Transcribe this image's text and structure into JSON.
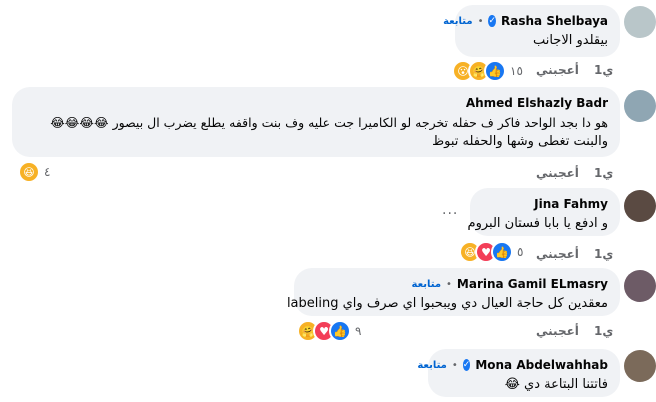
{
  "comments": [
    {
      "author": "Rasha Shelbaya",
      "follow_label": "متابعة",
      "verified": true,
      "text_lines": [
        "بيقلدو الاجانب"
      ],
      "like_label": "أعجبني",
      "time": "1ي",
      "reaction_count": "١٥",
      "reactions": [
        "wow",
        "care",
        "like"
      ]
    },
    {
      "author": "Ahmed Elshazly Badr",
      "verified": false,
      "text_lines": [
        "هو دا بجد الواحد فاكر ف حفله تخرجه لو الكاميرا جت عليه وف بنت واقفه يطلع يضرب ال بيصور 😂😂😂😂",
        "والبنت تغطى وشها والحفله تبوظ"
      ],
      "like_label": "أعجبني",
      "time": "1ي",
      "reaction_count": "٤",
      "reactions": [
        "haha"
      ]
    },
    {
      "author": "Jina Fahmy",
      "verified": false,
      "text_lines": [
        "و ادفع يا بابا فستان البروم"
      ],
      "more_label": "...",
      "like_label": "أعجبني",
      "time": "1ي",
      "reaction_count": "٥",
      "reactions": [
        "haha",
        "love",
        "like"
      ]
    },
    {
      "author": "Marina Gamil ELmasry",
      "follow_label": "متابعة",
      "verified": false,
      "text_lines": [
        "معقدين كل حاجة العيال دي ويبحبوا اي صرف واي labeling"
      ],
      "like_label": "أعجبني",
      "time": "1ي",
      "reaction_count": "٩",
      "reactions": [
        "care",
        "love",
        "like"
      ]
    },
    {
      "author": "Mona Abdelwahhab",
      "follow_label": "متابعة",
      "verified": true,
      "text_lines": [
        "فاتتنا البتاعة دي 😂"
      ]
    }
  ],
  "colors": {
    "bubble": "#f0f2f5",
    "follow": "#0064d1",
    "meta": "#65676b",
    "like": "#1877f2",
    "love": "#f33e58",
    "haha": "#f7b125"
  }
}
